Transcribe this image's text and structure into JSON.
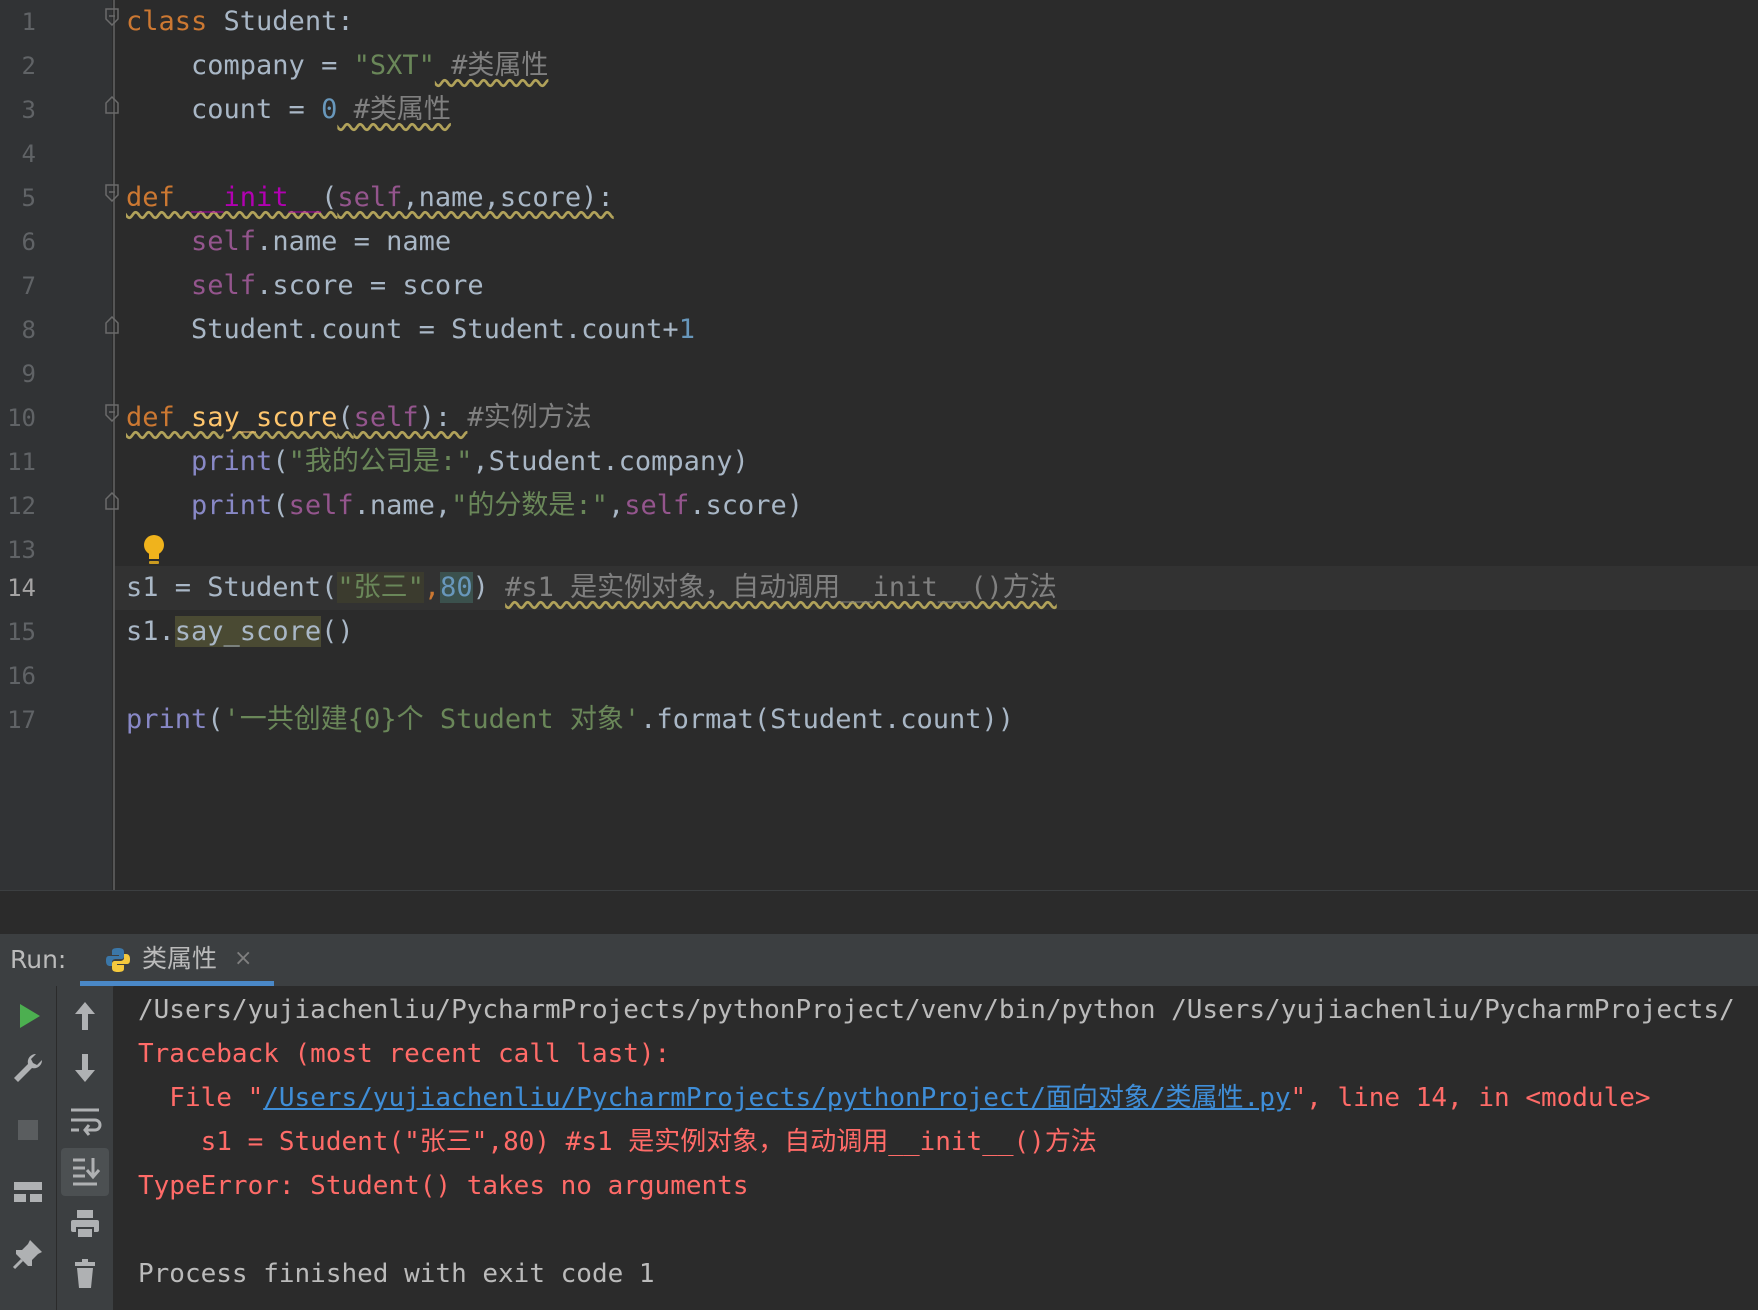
{
  "editor": {
    "line_numbers": [
      "1",
      "2",
      "3",
      "4",
      "5",
      "6",
      "7",
      "8",
      "9",
      "10",
      "11",
      "12",
      "13",
      "14",
      "15",
      "16",
      "17"
    ],
    "active_line": "14",
    "lines": {
      "l1": {
        "kw": "class",
        "rest": " Student:"
      },
      "l2": {
        "a": "    company = ",
        "s": "\"SXT\"",
        "c": " #类属性"
      },
      "l3": {
        "a": "    count = ",
        "n": "0",
        "c": " #类属性"
      },
      "l5": {
        "kw": "def ",
        "fn": "__init__",
        "p1": "(",
        "self": "self",
        "p2": ",name,score):"
      },
      "l6": {
        "a": "    ",
        "self": "self",
        "b": ".name = name"
      },
      "l7": {
        "a": "    ",
        "self": "self",
        "b": ".score = score"
      },
      "l8": {
        "a": "    Student.count = Student.count+",
        "n": "1"
      },
      "l10": {
        "kw": "def ",
        "fn": "say_score",
        "p1": "(",
        "self": "self",
        "p2": "): ",
        "c": "#实例方法"
      },
      "l11": {
        "a": "    ",
        "bi": "print",
        "p1": "(",
        "s": "\"我的公司是:\"",
        "b": ",Student.company)"
      },
      "l12": {
        "a": "    ",
        "bi": "print",
        "p1": "(",
        "self": "self",
        "b": ".name,",
        "s": "\"的分数是:\"",
        "c2": ",",
        "self2": "self",
        "d": ".score)"
      },
      "l14": {
        "a": "s1 = Student(",
        "s": "\"张三\"",
        "comma": ",",
        "n": "80",
        "b": ") ",
        "c": "#s1 是实例对象，自动调用__init__()方法"
      },
      "l15": {
        "a": "s1.",
        "call": "say_score",
        "b": "()"
      },
      "l17": {
        "bi": "print",
        "p1": "(",
        "s": "'一共创建{0}个 Student 对象'",
        "b": ".format(Student.count))"
      }
    }
  },
  "run_panel": {
    "label": "Run:",
    "tab_name": "类属性",
    "tab_close": "×"
  },
  "console": {
    "line1": "/Users/yujiachenliu/PycharmProjects/pythonProject/venv/bin/python /Users/yujiachenliu/PycharmProjects/",
    "line2": "Traceback (most recent call last):",
    "line3_pre": "  File \"",
    "line3_link": "/Users/yujiachenliu/PycharmProjects/pythonProject/面向对象/类属性.py",
    "line3_post": "\", line 14, in <module>",
    "line4": "    s1 = Student(\"张三\",80) #s1 是实例对象，自动调用__init__()方法",
    "line5": "TypeError: Student() takes no arguments",
    "line6": "Process finished with exit code 1"
  },
  "icons": {
    "run": "play-icon",
    "wrench": "wrench-icon",
    "stop": "stop-icon",
    "layout": "layout-icon",
    "pin": "pin-icon",
    "up": "arrow-up-icon",
    "down": "arrow-down-icon",
    "wrap": "soft-wrap-icon",
    "scroll": "scroll-to-end-icon",
    "print": "print-icon",
    "trash": "trash-icon",
    "python": "python-icon",
    "bulb": "lightbulb-icon"
  },
  "colors": {
    "accent": "#4a88c7",
    "error": "#ff6b68",
    "run_green": "#4caf50"
  }
}
